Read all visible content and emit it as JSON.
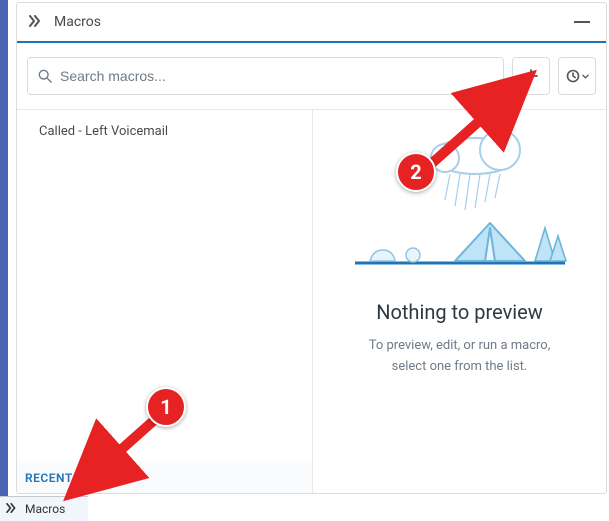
{
  "header": {
    "title": "Macros"
  },
  "search": {
    "placeholder": "Search macros..."
  },
  "list": {
    "items": [
      {
        "label": "Called - Left Voicemail"
      }
    ],
    "recent_label": "RECENT"
  },
  "preview": {
    "title": "Nothing to preview",
    "subtitle_line1": "To preview, edit, or run a macro,",
    "subtitle_line2": "select one from the list."
  },
  "taskbar": {
    "label": "Macros"
  },
  "annotations": {
    "badge1": "1",
    "badge2": "2"
  }
}
